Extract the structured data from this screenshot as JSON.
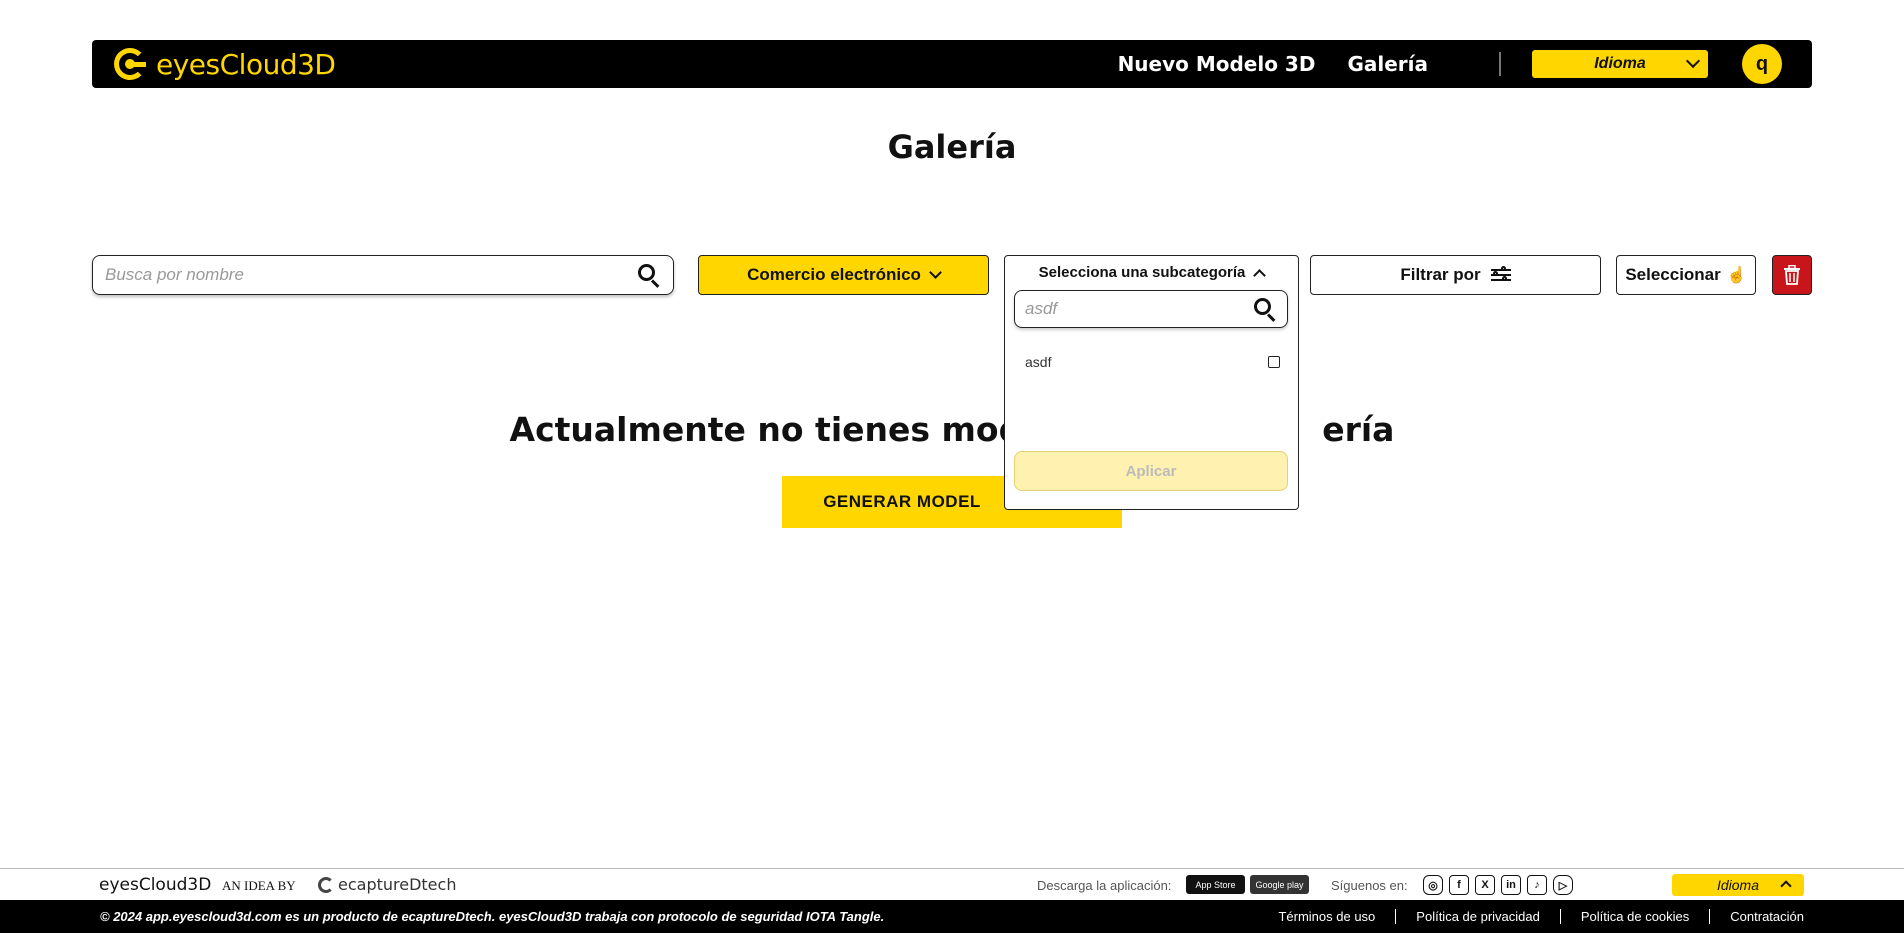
{
  "header": {
    "brand": "eyesCloud3D",
    "nav": [
      "Nuevo Modelo 3D",
      "Galería"
    ],
    "language_label": "Idioma",
    "avatar_initial": "q"
  },
  "page_title": "Galería",
  "toolbar": {
    "search_placeholder": "Busca por nombre",
    "category_label": "Comercio electrónico",
    "filter_label": "Filtrar por",
    "select_label": "Seleccionar"
  },
  "subcategory": {
    "title": "Selecciona una subcategoría",
    "search_value": "asdf",
    "options": [
      {
        "label": "asdf",
        "checked": false
      }
    ],
    "apply_label": "Aplicar"
  },
  "empty_state": {
    "message_left": "Actualmente no tienes mod",
    "message_right": "ería",
    "button_left": "GENERAR MODEL",
    "button_right": ""
  },
  "footer": {
    "brand": "eyesCloud3D",
    "idea_by": "AN IDEA BY",
    "company": "ecaptureDtech",
    "download_label": "Descarga la aplicación:",
    "app_store": "App Store",
    "google_play": "Google play",
    "follow_label": "Síguenos en:",
    "language_label": "Idioma",
    "copyright": "© 2024 app.eyescloud3d.com es un producto de ecaptureDtech. eyesCloud3D trabaja con protocolo de seguridad IOTA Tangle.",
    "links": [
      "Términos de uso",
      "Política de privacidad",
      "Política de cookies",
      "Contratación"
    ]
  },
  "colors": {
    "accent": "#ffd600",
    "danger": "#c8151b",
    "dark": "#000000"
  }
}
